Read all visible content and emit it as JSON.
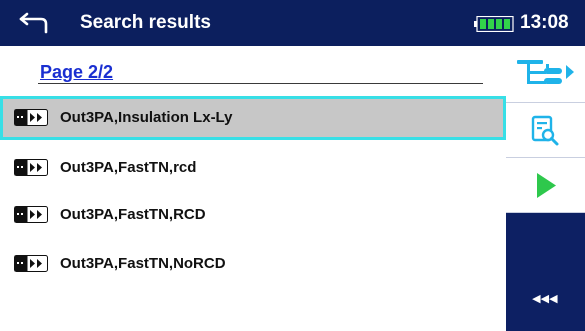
{
  "header": {
    "title": "Search results",
    "time": "13:08",
    "back_icon": "back-arrow-icon",
    "battery_icon": "battery-full-icon"
  },
  "pagination": {
    "label": "Page 2/2"
  },
  "results": [
    {
      "label": "Out3PA,Insulation Lx-Ly",
      "selected": true,
      "icon": "test-sequence-icon"
    },
    {
      "label": "Out3PA,FastTN,rcd",
      "selected": false,
      "icon": "test-sequence-icon"
    },
    {
      "label": "Out3PA,FastTN,RCD",
      "selected": false,
      "icon": "test-sequence-icon"
    },
    {
      "label": "Out3PA,FastTN,NoRCD",
      "selected": false,
      "icon": "test-sequence-icon"
    }
  ],
  "sidebar": {
    "buttons": [
      {
        "icon": "tree-options-icon"
      },
      {
        "icon": "view-details-icon"
      },
      {
        "icon": "play-icon"
      }
    ],
    "more_label": "◂◂◂"
  },
  "colors": {
    "header_bg": "#0c1f5e",
    "selection_border": "#38dfe6",
    "selection_bg": "#c7c7c7",
    "page_label": "#1a2fd1",
    "accent": "#1fb3e9"
  }
}
